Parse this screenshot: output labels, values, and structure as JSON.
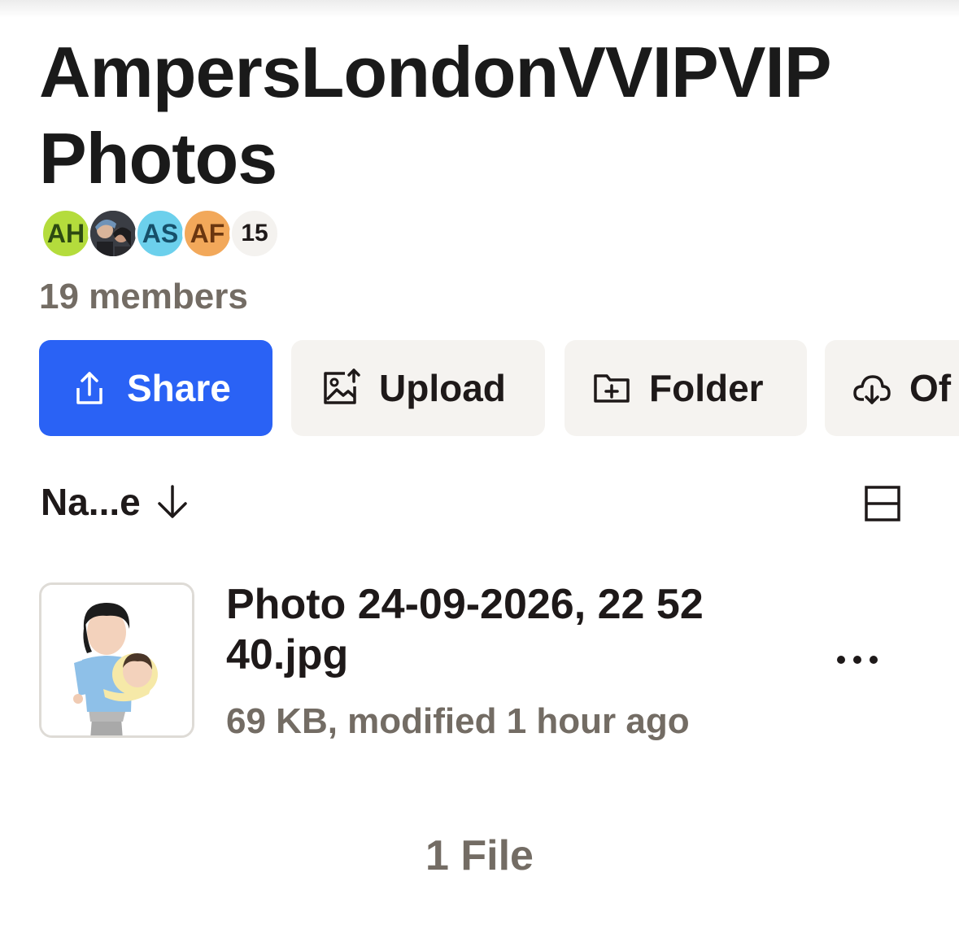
{
  "folder": {
    "title": "AmpersLondonVVIPVIP Photos",
    "members_label": "19 members",
    "avatars": [
      {
        "initials": "AH",
        "color": "#b4dc3c"
      },
      {
        "initials": "",
        "color": "#3c3c3c"
      },
      {
        "initials": "AS",
        "color": "#6cd0ec"
      },
      {
        "initials": "AF",
        "color": "#f2a85a"
      }
    ],
    "more_members": "15"
  },
  "actions": {
    "share": "Share",
    "upload": "Upload",
    "folder": "Folder",
    "offline": "Of"
  },
  "sort": {
    "label": "Na...e",
    "direction": "descending"
  },
  "files": [
    {
      "name": "Photo 24-09-2026, 22 52 40.jpg",
      "meta": "69 KB, modified 1 hour ago",
      "icon": "image-thumbnail"
    }
  ],
  "footer": {
    "count_label": "1 File"
  },
  "colors": {
    "primary": "#2a62f5",
    "secondary_bg": "#f5f3f0",
    "muted_text": "#736c64"
  }
}
